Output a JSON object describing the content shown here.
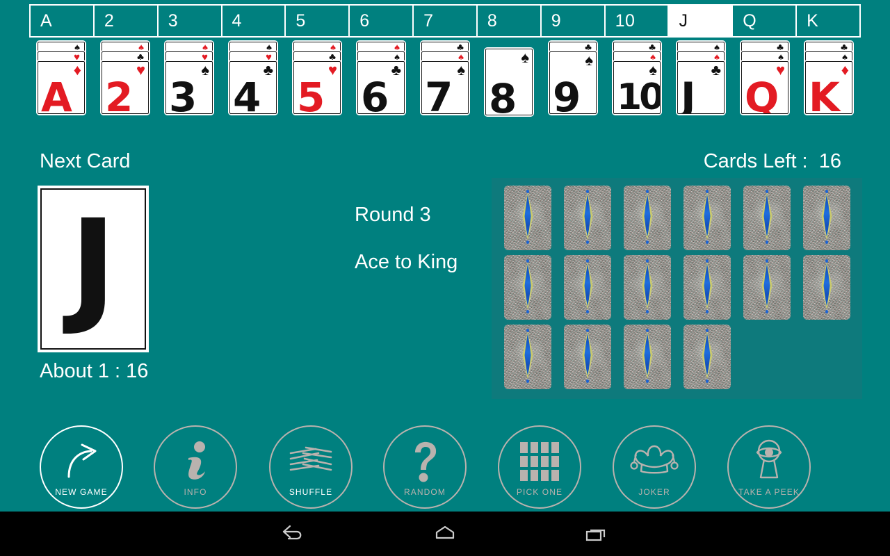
{
  "app": {
    "background_color": "#00807f",
    "accent_white": "#ffffff",
    "red_suit_color": "#e31b23",
    "black_suit_color": "#111111",
    "dimmed_color": "#b9b2ae",
    "deck_panel_color": "#0e7a7c"
  },
  "tabs": {
    "selected": "J",
    "items": [
      {
        "label": "A"
      },
      {
        "label": "2"
      },
      {
        "label": "3"
      },
      {
        "label": "4"
      },
      {
        "label": "5"
      },
      {
        "label": "6"
      },
      {
        "label": "7"
      },
      {
        "label": "8"
      },
      {
        "label": "9"
      },
      {
        "label": "10"
      },
      {
        "label": "J"
      },
      {
        "label": "Q"
      },
      {
        "label": "K"
      }
    ]
  },
  "piles": [
    {
      "rank": "A",
      "color": "red",
      "suit": "diamond",
      "count": 3,
      "back_pips": [
        "spade-black",
        "heart-red"
      ]
    },
    {
      "rank": "2",
      "color": "red",
      "suit": "heart",
      "count": 3,
      "back_pips": [
        "spade-red",
        "club-black"
      ]
    },
    {
      "rank": "3",
      "color": "black",
      "suit": "spade",
      "count": 3,
      "back_pips": [
        "spade-red",
        "heart-red"
      ]
    },
    {
      "rank": "4",
      "color": "black",
      "suit": "club",
      "count": 3,
      "back_pips": [
        "spade-black",
        "heart-red"
      ]
    },
    {
      "rank": "5",
      "color": "red",
      "suit": "heart",
      "count": 3,
      "back_pips": [
        "spade-red",
        "club-black"
      ]
    },
    {
      "rank": "6",
      "color": "black",
      "suit": "club",
      "count": 3,
      "back_pips": [
        "spade-red",
        "spade-black"
      ]
    },
    {
      "rank": "7",
      "color": "black",
      "suit": "spade",
      "count": 3,
      "back_pips": [
        "club-black",
        "spade-red"
      ]
    },
    {
      "rank": "8",
      "color": "black",
      "suit": "spade",
      "count": 1,
      "back_pips": []
    },
    {
      "rank": "9",
      "color": "black",
      "suit": "spade",
      "count": 2,
      "back_pips": [
        "club-black"
      ]
    },
    {
      "rank": "10",
      "color": "black",
      "suit": "spade",
      "count": 3,
      "back_pips": [
        "club-black",
        "spade-red"
      ]
    },
    {
      "rank": "J",
      "color": "black",
      "suit": "club",
      "count": 3,
      "back_pips": [
        "spade-black",
        "spade-red"
      ]
    },
    {
      "rank": "Q",
      "color": "red",
      "suit": "heart",
      "count": 3,
      "back_pips": [
        "club-black",
        "spade-black"
      ]
    },
    {
      "rank": "K",
      "color": "red",
      "suit": "diamond",
      "count": 3,
      "back_pips": [
        "club-black",
        "spade-black"
      ]
    }
  ],
  "next_card": {
    "label": "Next Card",
    "rank": "J",
    "odds_label": "About 1 :  16"
  },
  "status": {
    "round": "Round 3",
    "mode": "Ace to King",
    "cards_left": "Cards Left :  16"
  },
  "deck": {
    "remaining": 16,
    "columns": 6,
    "card_back": "peacock-feather-back"
  },
  "actions": [
    {
      "id": "new-game",
      "label": "NEW GAME",
      "icon": "curved-arrow-icon",
      "enabled": true,
      "bright_label": true
    },
    {
      "id": "info",
      "label": "INFO",
      "icon": "info-icon",
      "enabled": false,
      "bright_label": false
    },
    {
      "id": "shuffle",
      "label": "SHUFFLE",
      "icon": "shuffle-icon",
      "enabled": false,
      "bright_label": true
    },
    {
      "id": "random",
      "label": "RANDOM",
      "icon": "question-icon",
      "enabled": false,
      "bright_label": false
    },
    {
      "id": "pick-one",
      "label": "PICK ONE",
      "icon": "grid-icon",
      "enabled": false,
      "bright_label": false
    },
    {
      "id": "joker",
      "label": "JOKER",
      "icon": "joker-hat-icon",
      "enabled": false,
      "bright_label": false
    },
    {
      "id": "take-a-peek",
      "label": "TAKE A PEEK",
      "icon": "keyhole-eye-icon",
      "enabled": false,
      "bright_label": false
    }
  ],
  "nav_bar": {
    "back": "back-icon",
    "home": "home-icon",
    "recents": "recents-icon"
  }
}
